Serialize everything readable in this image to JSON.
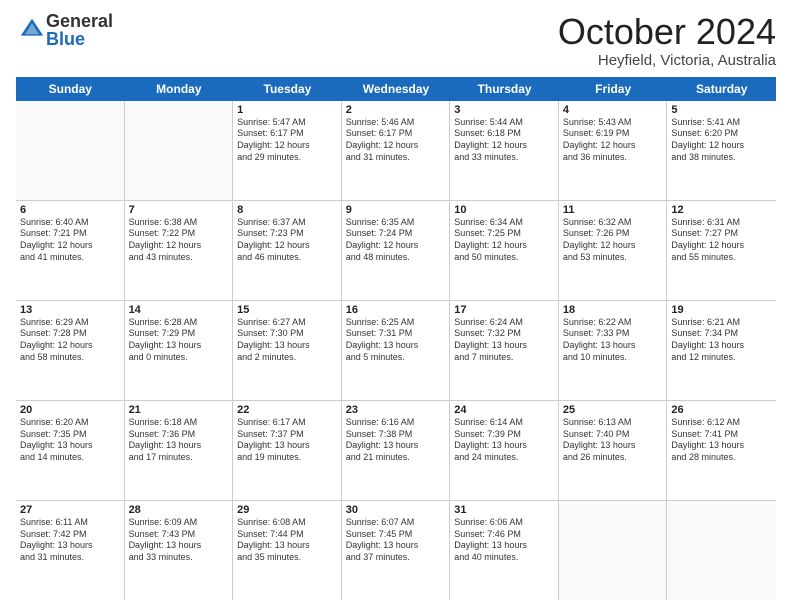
{
  "header": {
    "logo_general": "General",
    "logo_blue": "Blue",
    "month_title": "October 2024",
    "location": "Heyfield, Victoria, Australia"
  },
  "weekdays": [
    "Sunday",
    "Monday",
    "Tuesday",
    "Wednesday",
    "Thursday",
    "Friday",
    "Saturday"
  ],
  "rows": [
    [
      {
        "day": "",
        "info": ""
      },
      {
        "day": "",
        "info": ""
      },
      {
        "day": "1",
        "info": "Sunrise: 5:47 AM\nSunset: 6:17 PM\nDaylight: 12 hours\nand 29 minutes."
      },
      {
        "day": "2",
        "info": "Sunrise: 5:46 AM\nSunset: 6:17 PM\nDaylight: 12 hours\nand 31 minutes."
      },
      {
        "day": "3",
        "info": "Sunrise: 5:44 AM\nSunset: 6:18 PM\nDaylight: 12 hours\nand 33 minutes."
      },
      {
        "day": "4",
        "info": "Sunrise: 5:43 AM\nSunset: 6:19 PM\nDaylight: 12 hours\nand 36 minutes."
      },
      {
        "day": "5",
        "info": "Sunrise: 5:41 AM\nSunset: 6:20 PM\nDaylight: 12 hours\nand 38 minutes."
      }
    ],
    [
      {
        "day": "6",
        "info": "Sunrise: 6:40 AM\nSunset: 7:21 PM\nDaylight: 12 hours\nand 41 minutes."
      },
      {
        "day": "7",
        "info": "Sunrise: 6:38 AM\nSunset: 7:22 PM\nDaylight: 12 hours\nand 43 minutes."
      },
      {
        "day": "8",
        "info": "Sunrise: 6:37 AM\nSunset: 7:23 PM\nDaylight: 12 hours\nand 46 minutes."
      },
      {
        "day": "9",
        "info": "Sunrise: 6:35 AM\nSunset: 7:24 PM\nDaylight: 12 hours\nand 48 minutes."
      },
      {
        "day": "10",
        "info": "Sunrise: 6:34 AM\nSunset: 7:25 PM\nDaylight: 12 hours\nand 50 minutes."
      },
      {
        "day": "11",
        "info": "Sunrise: 6:32 AM\nSunset: 7:26 PM\nDaylight: 12 hours\nand 53 minutes."
      },
      {
        "day": "12",
        "info": "Sunrise: 6:31 AM\nSunset: 7:27 PM\nDaylight: 12 hours\nand 55 minutes."
      }
    ],
    [
      {
        "day": "13",
        "info": "Sunrise: 6:29 AM\nSunset: 7:28 PM\nDaylight: 12 hours\nand 58 minutes."
      },
      {
        "day": "14",
        "info": "Sunrise: 6:28 AM\nSunset: 7:29 PM\nDaylight: 13 hours\nand 0 minutes."
      },
      {
        "day": "15",
        "info": "Sunrise: 6:27 AM\nSunset: 7:30 PM\nDaylight: 13 hours\nand 2 minutes."
      },
      {
        "day": "16",
        "info": "Sunrise: 6:25 AM\nSunset: 7:31 PM\nDaylight: 13 hours\nand 5 minutes."
      },
      {
        "day": "17",
        "info": "Sunrise: 6:24 AM\nSunset: 7:32 PM\nDaylight: 13 hours\nand 7 minutes."
      },
      {
        "day": "18",
        "info": "Sunrise: 6:22 AM\nSunset: 7:33 PM\nDaylight: 13 hours\nand 10 minutes."
      },
      {
        "day": "19",
        "info": "Sunrise: 6:21 AM\nSunset: 7:34 PM\nDaylight: 13 hours\nand 12 minutes."
      }
    ],
    [
      {
        "day": "20",
        "info": "Sunrise: 6:20 AM\nSunset: 7:35 PM\nDaylight: 13 hours\nand 14 minutes."
      },
      {
        "day": "21",
        "info": "Sunrise: 6:18 AM\nSunset: 7:36 PM\nDaylight: 13 hours\nand 17 minutes."
      },
      {
        "day": "22",
        "info": "Sunrise: 6:17 AM\nSunset: 7:37 PM\nDaylight: 13 hours\nand 19 minutes."
      },
      {
        "day": "23",
        "info": "Sunrise: 6:16 AM\nSunset: 7:38 PM\nDaylight: 13 hours\nand 21 minutes."
      },
      {
        "day": "24",
        "info": "Sunrise: 6:14 AM\nSunset: 7:39 PM\nDaylight: 13 hours\nand 24 minutes."
      },
      {
        "day": "25",
        "info": "Sunrise: 6:13 AM\nSunset: 7:40 PM\nDaylight: 13 hours\nand 26 minutes."
      },
      {
        "day": "26",
        "info": "Sunrise: 6:12 AM\nSunset: 7:41 PM\nDaylight: 13 hours\nand 28 minutes."
      }
    ],
    [
      {
        "day": "27",
        "info": "Sunrise: 6:11 AM\nSunset: 7:42 PM\nDaylight: 13 hours\nand 31 minutes."
      },
      {
        "day": "28",
        "info": "Sunrise: 6:09 AM\nSunset: 7:43 PM\nDaylight: 13 hours\nand 33 minutes."
      },
      {
        "day": "29",
        "info": "Sunrise: 6:08 AM\nSunset: 7:44 PM\nDaylight: 13 hours\nand 35 minutes."
      },
      {
        "day": "30",
        "info": "Sunrise: 6:07 AM\nSunset: 7:45 PM\nDaylight: 13 hours\nand 37 minutes."
      },
      {
        "day": "31",
        "info": "Sunrise: 6:06 AM\nSunset: 7:46 PM\nDaylight: 13 hours\nand 40 minutes."
      },
      {
        "day": "",
        "info": ""
      },
      {
        "day": "",
        "info": ""
      }
    ]
  ]
}
